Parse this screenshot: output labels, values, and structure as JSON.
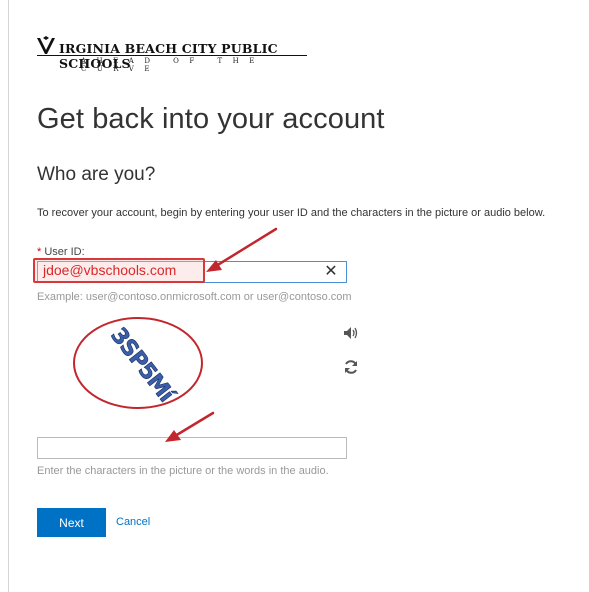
{
  "brand": {
    "name": "IRGINIA BEACH CITY PUBLIC SCHOOLS",
    "initial_mark": "V",
    "tagline": "AHEAD OF THE CURVE"
  },
  "header": {
    "title": "Get back into your account",
    "subtitle": "Who are you?"
  },
  "form": {
    "instructions": "To recover your account, begin by entering your user ID and the characters in the picture or audio below.",
    "required_marker": "*",
    "userid_label": "User ID:",
    "userid_value": "jdoe@vbschools.com",
    "userid_example": "Example: user@contoso.onmicrosoft.com or user@contoso.com",
    "captcha_text": "3SP5Mí",
    "captcha_value": "",
    "captcha_help": "Enter the characters in the picture or the words in the audio.",
    "next_label": "Next",
    "cancel_label": "Cancel"
  },
  "icons": {
    "clear": "close-icon",
    "audio": "speaker-icon",
    "refresh": "refresh-icon"
  },
  "colors": {
    "accent": "#0072c6",
    "annotation": "#c1272d",
    "userid_text": "#d92929",
    "input_focus_border": "#4a90d9"
  }
}
